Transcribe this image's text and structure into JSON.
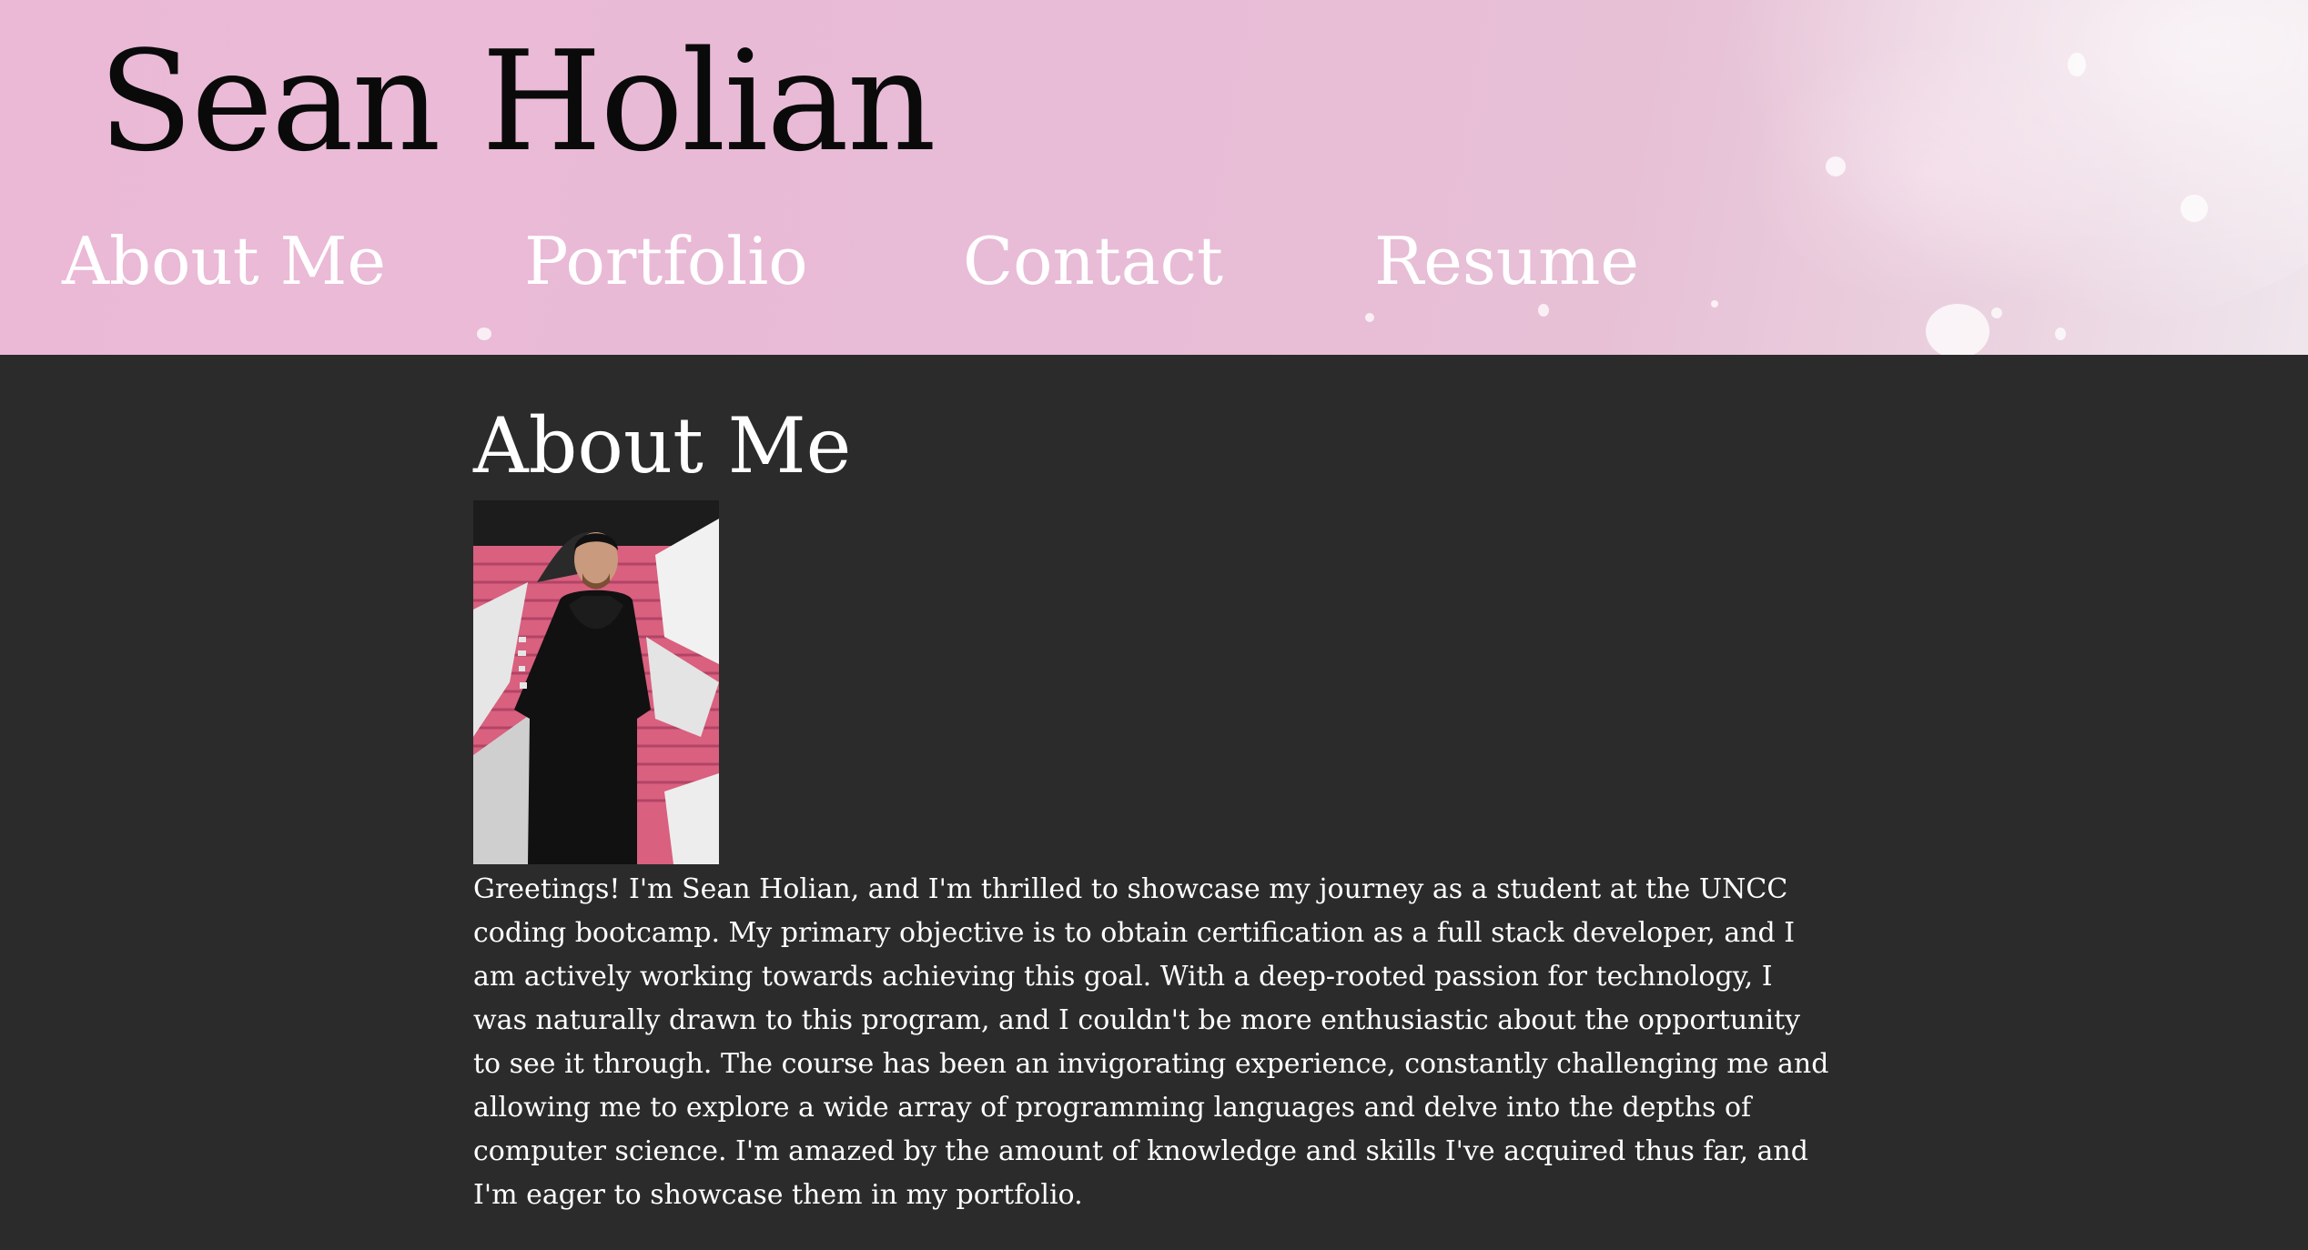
{
  "header": {
    "title": "Sean Holian",
    "nav": [
      {
        "label": "About Me"
      },
      {
        "label": "Portfolio"
      },
      {
        "label": "Contact"
      },
      {
        "label": "Resume"
      }
    ]
  },
  "about": {
    "heading": "About Me",
    "photo_alt": "Sean Holian",
    "bio": "Greetings! I'm Sean Holian, and I'm thrilled to showcase my journey as a student at the UNCC coding bootcamp. My primary objective is to obtain certification as a full stack developer, and I am actively working towards achieving this goal. With a deep-rooted passion for technology, I was naturally drawn to this program, and I couldn't be more enthusiastic about the opportunity to see it through. The course has been an invigorating experience, constantly challenging me and allowing me to explore a wide array of programming languages and delve into the depths of computer science. I'm amazed by the amount of knowledge and skills I've acquired thus far, and I'm eager to showcase them in my portfolio."
  },
  "colors": {
    "header_pink": "#ebb9d6",
    "body_background": "#2b2b2b",
    "title_text": "#0a0a0a",
    "nav_text": "#ffffff"
  }
}
